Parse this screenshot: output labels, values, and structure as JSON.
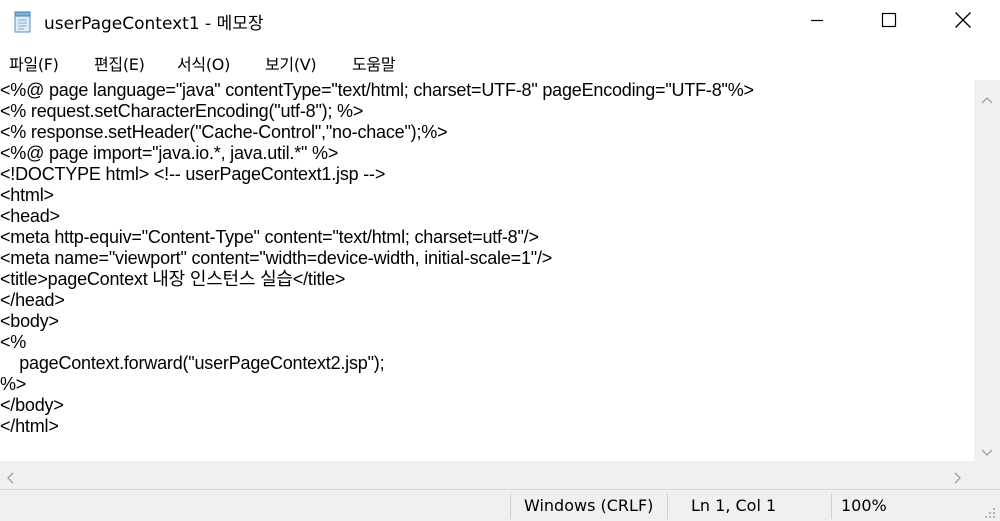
{
  "window": {
    "title": "userPageContext1 - 메모장",
    "app_icon": "notepad-icon",
    "buttons": {
      "minimize_icon": "minimize-icon",
      "maximize_icon": "maximize-icon",
      "close_icon": "close-icon"
    }
  },
  "menu": {
    "items": [
      {
        "label": "파일(F)"
      },
      {
        "label": "편집(E)"
      },
      {
        "label": "서식(O)"
      },
      {
        "label": "보기(V)"
      },
      {
        "label": "도움말"
      }
    ]
  },
  "editor": {
    "lines": [
      "<%@ page language=\"java\" contentType=\"text/html; charset=UTF-8\" pageEncoding=\"UTF-8\"%>",
      "<% request.setCharacterEncoding(\"utf-8\"); %>",
      "<% response.setHeader(\"Cache-Control\",\"no-chace\");%>",
      "<%@ page import=\"java.io.*, java.util.*\" %>",
      "<!DOCTYPE html> <!-- userPageContext1.jsp -->",
      "<html>",
      "<head>",
      "<meta http-equiv=\"Content-Type\" content=\"text/html; charset=utf-8\"/>",
      "<meta name=\"viewport\" content=\"width=device-width, initial-scale=1\"/>",
      "<title>pageContext 내장 인스턴스 실습</title>",
      "</head>",
      "<body>",
      "<%",
      "    pageContext.forward(\"userPageContext2.jsp\");",
      "%>",
      "</body>",
      "</html>"
    ]
  },
  "statusbar": {
    "line_ending": "Windows (CRLF)",
    "position": "Ln 1, Col 1",
    "zoom": "100%"
  },
  "colors": {
    "chrome_bg": "#f0f0f0",
    "editor_bg": "#ffffff",
    "text": "#000000"
  }
}
